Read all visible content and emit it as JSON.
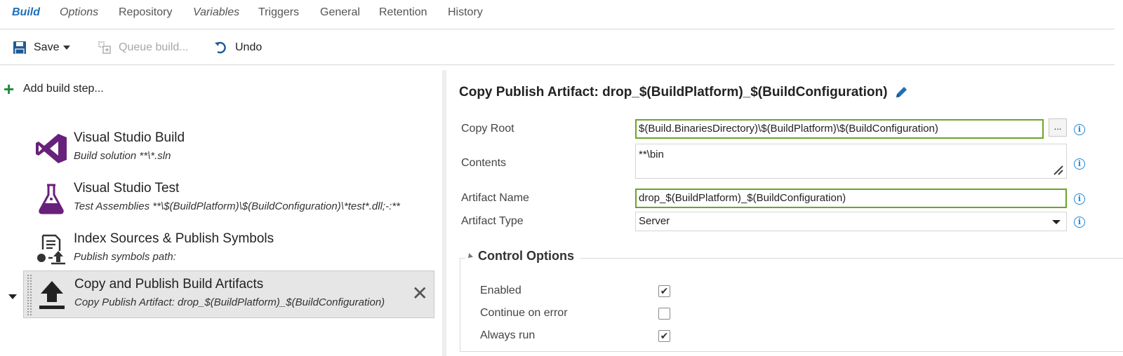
{
  "tabs": [
    {
      "label": "Build",
      "active": true
    },
    {
      "label": "Options"
    },
    {
      "label": "Repository"
    },
    {
      "label": "Variables"
    },
    {
      "label": "Triggers"
    },
    {
      "label": "General"
    },
    {
      "label": "Retention"
    },
    {
      "label": "History"
    }
  ],
  "toolbar": {
    "save_label": "Save",
    "queue_label": "Queue build...",
    "undo_label": "Undo"
  },
  "left": {
    "add_step_label": "Add build step...",
    "steps": [
      {
        "title": "Visual Studio Build",
        "subtitle": "Build solution **\\*.sln",
        "icon": "visual-studio-icon"
      },
      {
        "title": "Visual Studio Test",
        "subtitle": "Test Assemblies **\\$(BuildPlatform)\\$(BuildConfiguration)\\*test*.dll;-:**",
        "icon": "flask-icon"
      },
      {
        "title": "Index Sources & Publish Symbols",
        "subtitle": "Publish symbols path:",
        "icon": "publish-symbols-icon"
      },
      {
        "title": "Copy and Publish Build Artifacts",
        "subtitle": "Copy Publish Artifact: drop_$(BuildPlatform)_$(BuildConfiguration)",
        "icon": "upload-icon",
        "selected": true
      }
    ],
    "remove_glyph": "✕"
  },
  "right": {
    "title": "Copy Publish Artifact: drop_$(BuildPlatform)_$(BuildConfiguration)",
    "fields": {
      "copy_root_label": "Copy Root",
      "copy_root_value": "$(Build.BinariesDirectory)\\$(BuildPlatform)\\$(BuildConfiguration)",
      "browse_label": "...",
      "contents_label": "Contents",
      "contents_value": "**\\bin",
      "artifact_name_label": "Artifact Name",
      "artifact_name_value": "drop_$(BuildPlatform)_$(BuildConfiguration)",
      "artifact_type_label": "Artifact Type",
      "artifact_type_value": "Server"
    },
    "info_glyph": "i",
    "control_options": {
      "heading": "Control Options",
      "options": [
        {
          "label": "Enabled",
          "checked": true
        },
        {
          "label": "Continue on error",
          "checked": false
        },
        {
          "label": "Always run",
          "checked": true
        }
      ]
    }
  },
  "colors": {
    "accent": "#1e6fb8",
    "valid_border": "#6aa526",
    "add_green": "#1d8c3a",
    "vs_purple": "#68217a",
    "info_blue": "#1e88d2"
  }
}
